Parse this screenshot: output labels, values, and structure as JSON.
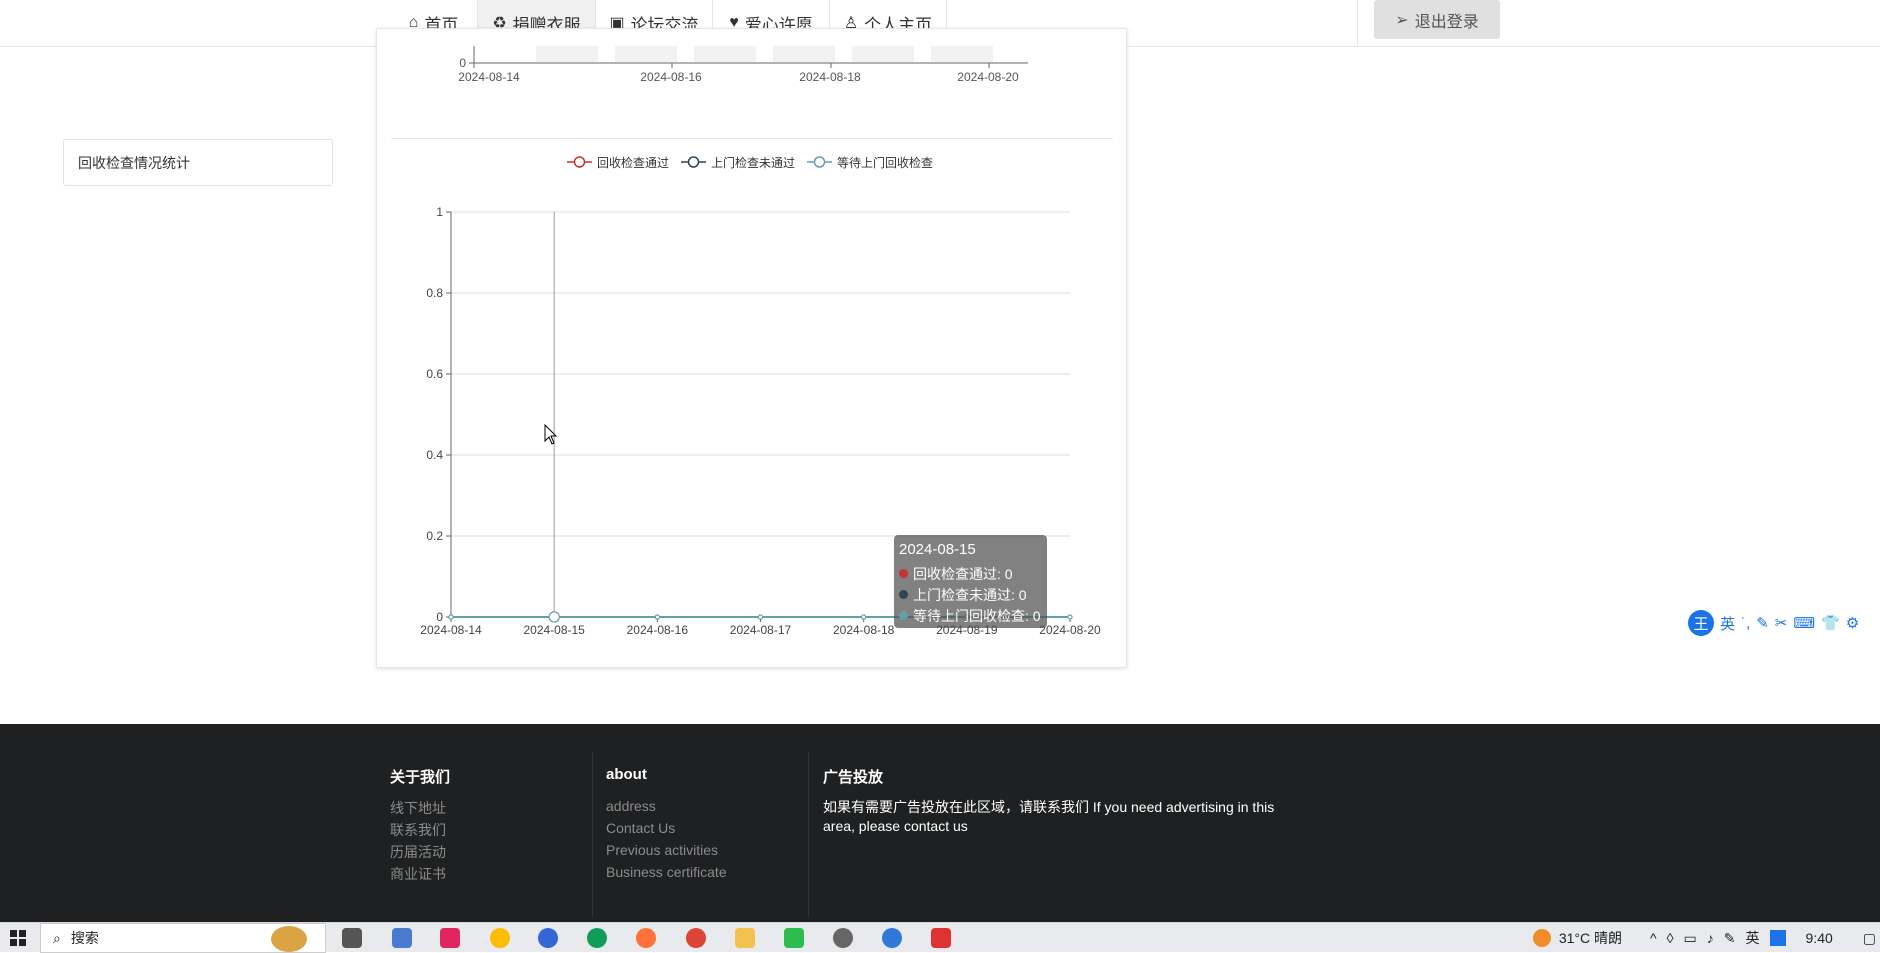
{
  "nav": {
    "items": [
      {
        "icon": "home-icon",
        "label": "首页"
      },
      {
        "icon": "recycle-icon",
        "label": "捐赠衣服"
      },
      {
        "icon": "forum-icon",
        "label": "论坛交流"
      },
      {
        "icon": "heart-icon",
        "label": "爱心许愿"
      },
      {
        "icon": "user-icon",
        "label": "个人主页"
      }
    ],
    "logout_label": "退出登录"
  },
  "sidebar": {
    "item_label": "回收检查情况统计"
  },
  "top_chart": {
    "x_ticks": [
      "2024-08-14",
      "2024-08-16",
      "2024-08-18",
      "2024-08-20"
    ],
    "y_tick": "0"
  },
  "chart_data": {
    "type": "line",
    "categories": [
      "2024-08-14",
      "2024-08-15",
      "2024-08-16",
      "2024-08-17",
      "2024-08-18",
      "2024-08-19",
      "2024-08-20"
    ],
    "series": [
      {
        "name": "回收检查通过",
        "values": [
          0,
          0,
          0,
          0,
          0,
          0,
          0
        ],
        "color": "#c23531"
      },
      {
        "name": "上门检查未通过",
        "values": [
          0,
          0,
          0,
          0,
          0,
          0,
          0
        ],
        "color": "#2f4554"
      },
      {
        "name": "等待上门回收检查",
        "values": [
          0,
          0,
          0,
          0,
          0,
          0,
          0
        ],
        "color": "#61a0a8"
      }
    ],
    "y_ticks": [
      "0",
      "0.2",
      "0.4",
      "0.6",
      "0.8",
      "1"
    ],
    "ylim": [
      0,
      1
    ],
    "legend_position": "top",
    "grid": true
  },
  "tooltip": {
    "title": "2024-08-15",
    "rows": [
      {
        "label": "回收检查通过: 0",
        "color": "#c23531"
      },
      {
        "label": "上门检查未通过: 0",
        "color": "#2f4554"
      },
      {
        "label": "等待上门回收检查: 0",
        "color": "#61a0a8"
      }
    ]
  },
  "ime": {
    "logo": "王",
    "lang": "英"
  },
  "footer": {
    "col1": {
      "title": "关于我们",
      "links": [
        "线下地址",
        "联系我们",
        "历届活动",
        "商业证书"
      ]
    },
    "col2": {
      "title": "about",
      "links": [
        "address",
        "Contact Us",
        "Previous activities",
        "Business certificate"
      ]
    },
    "col3": {
      "title": "广告投放",
      "text": "如果有需要广告投放在此区域，请联系我们 If you need advertising in this area, please contact us"
    }
  },
  "taskbar": {
    "search_label": "搜索",
    "weather": "31°C  晴朗",
    "ime_lang": "英",
    "time": "9:40"
  }
}
